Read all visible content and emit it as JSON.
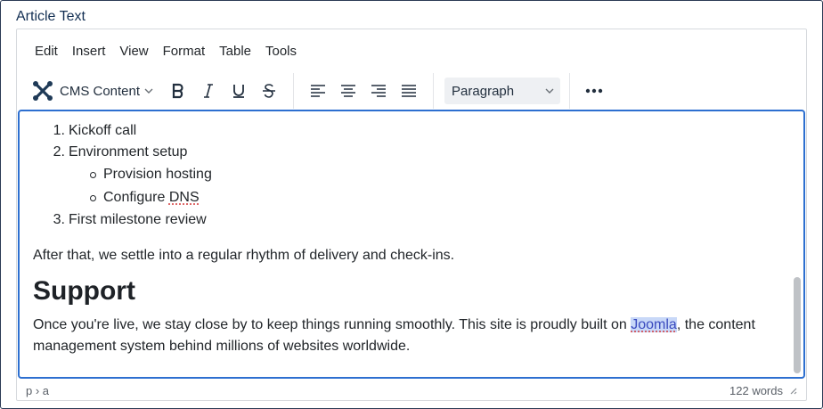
{
  "field_label": "Article Text",
  "menubar": [
    "Edit",
    "Insert",
    "View",
    "Format",
    "Table",
    "Tools"
  ],
  "toolbar": {
    "cms_label": "CMS Content",
    "format_select": "Paragraph"
  },
  "content": {
    "ordered_list": [
      {
        "num": "1.",
        "text": "Kickoff call"
      },
      {
        "num": "2.",
        "text": "Environment setup"
      },
      {
        "num": "3.",
        "text": "First milestone review"
      }
    ],
    "sub_list": [
      "Provision hosting",
      "Configure "
    ],
    "sub_list_misspelled": "DNS",
    "paragraph1": "After that, we settle into a regular rhythm of delivery and check-ins.",
    "heading": "Support",
    "paragraph2_before": "Once you're live, we stay close by to keep things running smoothly. This site is proudly built on ",
    "paragraph2_link": "Joomla",
    "paragraph2_after": ", the content management system behind millions of websites worldwide."
  },
  "statusbar": {
    "path": "p › a",
    "word_count": "122 words"
  },
  "colors": {
    "accent": "#2d6fd0",
    "label": "#132f53",
    "selection": "#c8d8f8"
  }
}
